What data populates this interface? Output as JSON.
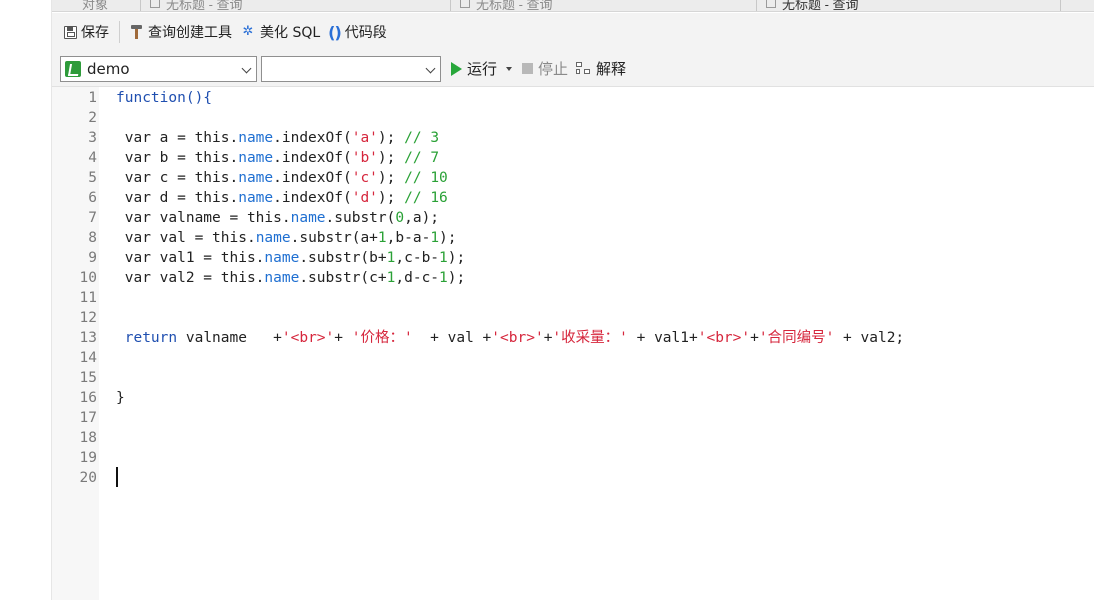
{
  "tabs": [
    {
      "label": "对象",
      "active": false
    },
    {
      "label": "无标题 - 查询",
      "active": false
    },
    {
      "label": "无标题 - 查询",
      "active": false
    },
    {
      "label": "无标题 - 查询",
      "active": true
    }
  ],
  "toolbar": {
    "save_label": "保存",
    "query_builder_label": "查询创建工具",
    "beautify_label": "美化 SQL",
    "snippet_label": "代码段"
  },
  "query_bar": {
    "connection_value": "demo",
    "database_value": "",
    "run_label": "运行",
    "stop_label": "停止",
    "explain_label": "解释"
  },
  "editor": {
    "line_numbers": [
      "1",
      "2",
      "3",
      "4",
      "5",
      "6",
      "7",
      "8",
      "9",
      "10",
      "11",
      "12",
      "13",
      "14",
      "15",
      "16",
      "17",
      "18",
      "19",
      "20"
    ],
    "colors": {
      "keyword": "#1f4fb0",
      "property": "#1f6fd1",
      "string": "#d6263c",
      "number": "#2aa136"
    },
    "lines": [
      [
        {
          "t": "function(){",
          "c": "kw"
        }
      ],
      [],
      [
        {
          "t": " var a = this."
        },
        {
          "t": "name",
          "c": "prop"
        },
        {
          "t": ".indexOf("
        },
        {
          "t": "'a'",
          "c": "str"
        },
        {
          "t": "); "
        },
        {
          "t": "// 3",
          "c": "cmt"
        }
      ],
      [
        {
          "t": " var b = this."
        },
        {
          "t": "name",
          "c": "prop"
        },
        {
          "t": ".indexOf("
        },
        {
          "t": "'b'",
          "c": "str"
        },
        {
          "t": "); "
        },
        {
          "t": "// 7",
          "c": "cmt"
        }
      ],
      [
        {
          "t": " var c = this."
        },
        {
          "t": "name",
          "c": "prop"
        },
        {
          "t": ".indexOf("
        },
        {
          "t": "'c'",
          "c": "str"
        },
        {
          "t": "); "
        },
        {
          "t": "// 10",
          "c": "cmt"
        }
      ],
      [
        {
          "t": " var d = this."
        },
        {
          "t": "name",
          "c": "prop"
        },
        {
          "t": ".indexOf("
        },
        {
          "t": "'d'",
          "c": "str"
        },
        {
          "t": "); "
        },
        {
          "t": "// 16",
          "c": "cmt"
        }
      ],
      [
        {
          "t": " var valname = this."
        },
        {
          "t": "name",
          "c": "prop"
        },
        {
          "t": ".substr("
        },
        {
          "t": "0",
          "c": "num"
        },
        {
          "t": ",a);"
        }
      ],
      [
        {
          "t": " var val = this."
        },
        {
          "t": "name",
          "c": "prop"
        },
        {
          "t": ".substr(a+"
        },
        {
          "t": "1",
          "c": "num"
        },
        {
          "t": ",b-a-"
        },
        {
          "t": "1",
          "c": "num"
        },
        {
          "t": ");"
        }
      ],
      [
        {
          "t": " var val1 = this."
        },
        {
          "t": "name",
          "c": "prop"
        },
        {
          "t": ".substr(b+"
        },
        {
          "t": "1",
          "c": "num"
        },
        {
          "t": ",c-b-"
        },
        {
          "t": "1",
          "c": "num"
        },
        {
          "t": ");"
        }
      ],
      [
        {
          "t": " var val2 = this."
        },
        {
          "t": "name",
          "c": "prop"
        },
        {
          "t": ".substr(c+"
        },
        {
          "t": "1",
          "c": "num"
        },
        {
          "t": ",d-c-"
        },
        {
          "t": "1",
          "c": "num"
        },
        {
          "t": ");"
        }
      ],
      [],
      [],
      [
        {
          "t": " "
        },
        {
          "t": "return",
          "c": "kw"
        },
        {
          "t": " valname   +"
        },
        {
          "t": "'<br>'",
          "c": "str"
        },
        {
          "t": "+ "
        },
        {
          "t": "'价格：'",
          "c": "str"
        },
        {
          "t": "  + val +"
        },
        {
          "t": "'<br>'",
          "c": "str"
        },
        {
          "t": "+"
        },
        {
          "t": "'收采量：'",
          "c": "str"
        },
        {
          "t": " + val1+"
        },
        {
          "t": "'<br>'",
          "c": "str"
        },
        {
          "t": "+"
        },
        {
          "t": "'合同编号'",
          "c": "str"
        },
        {
          "t": " + val2;"
        }
      ],
      [],
      [],
      [
        {
          "t": "}"
        }
      ],
      [],
      [],
      [],
      []
    ]
  }
}
